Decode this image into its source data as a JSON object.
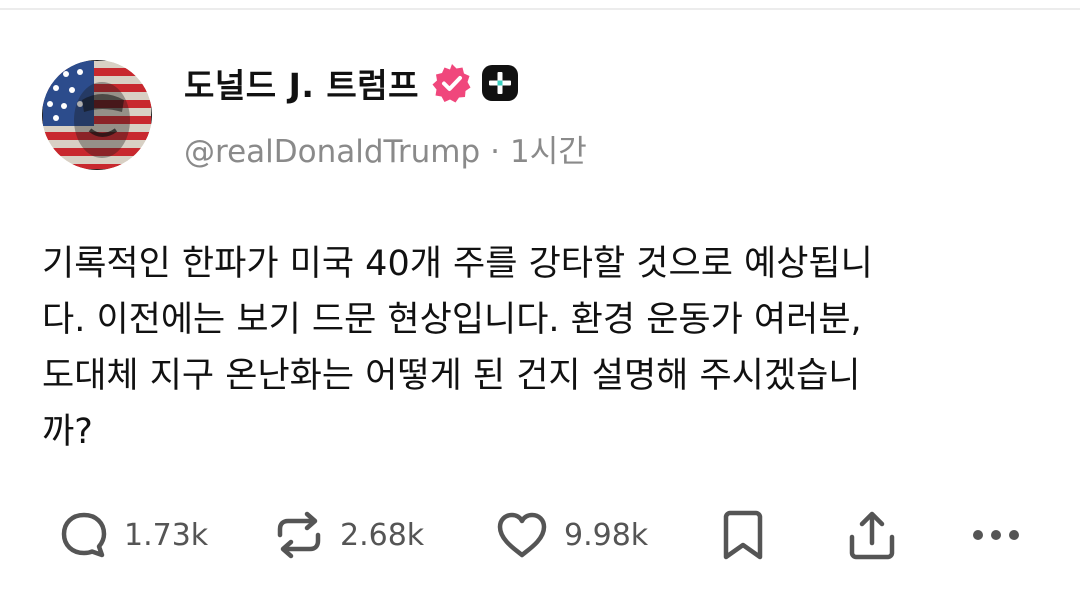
{
  "author": {
    "display_name": "도널드 J. 트럼프",
    "handle": "@realDonaldTrump",
    "separator": "·",
    "time_ago": "1시간",
    "avatar_icon": "flag-portrait-avatar",
    "verified_icon": "verified-badge-icon",
    "verified_color": "#f0477c",
    "platform_icon": "plus-app-icon"
  },
  "post": {
    "lines": [
      "기록적인 한파가 미국 40개 주를 강타할 것으로 예상됩니",
      "다. 이전에는 보기 드문 현상입니다. 환경 운동가 여러분,",
      "도대체 지구 온난화는 어떻게 된 건지 설명해 주시겠습니",
      "까?"
    ]
  },
  "actions": {
    "reply": {
      "icon": "reply-icon",
      "count": "1.73k"
    },
    "repost": {
      "icon": "repost-icon",
      "count": "2.68k"
    },
    "like": {
      "icon": "heart-icon",
      "count": "9.98k"
    },
    "bookmark": {
      "icon": "bookmark-icon"
    },
    "share": {
      "icon": "share-icon"
    },
    "more": {
      "icon": "more-icon"
    }
  }
}
